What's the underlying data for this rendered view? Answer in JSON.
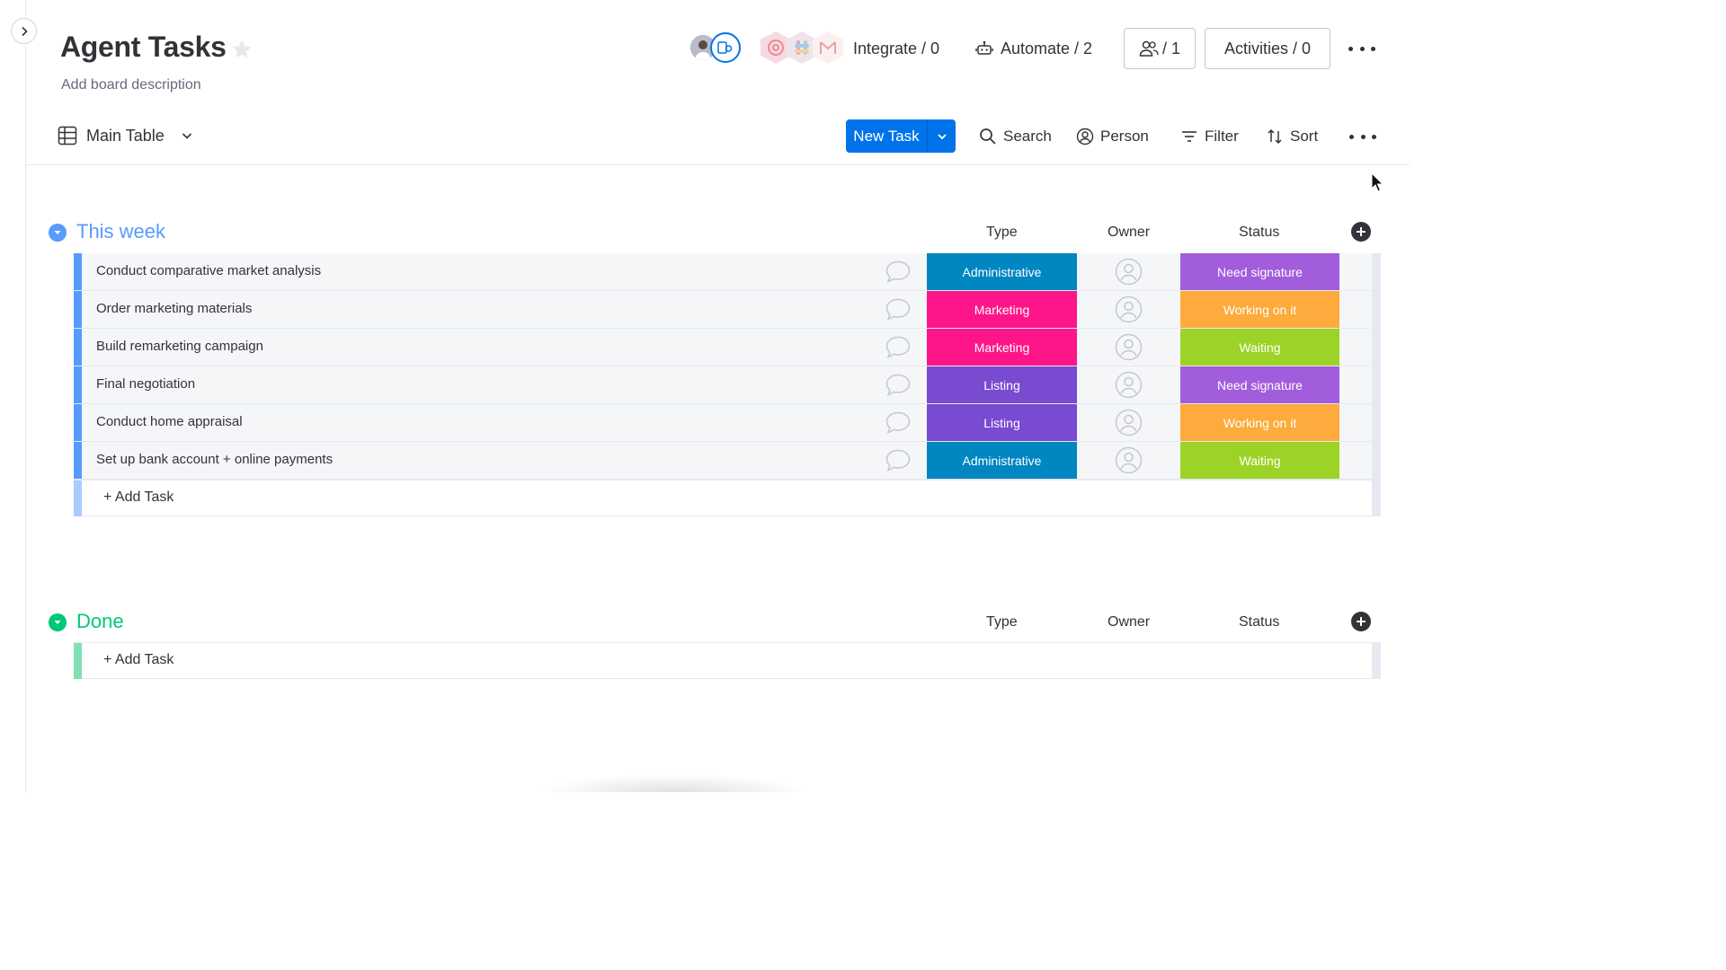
{
  "board": {
    "title": "Agent Tasks",
    "description": "Add board description"
  },
  "header": {
    "integrate_label": "Integrate / 0",
    "automate_label": "Automate / 2",
    "members_count": "/ 1",
    "activities_label": "Activities / 0"
  },
  "toolbar": {
    "view_label": "Main Table",
    "new_task_label": "New Task",
    "search_label": "Search",
    "person_label": "Person",
    "filter_label": "Filter",
    "sort_label": "Sort"
  },
  "columns": {
    "type": "Type",
    "owner": "Owner",
    "status": "Status"
  },
  "groups": [
    {
      "title": "This week",
      "color": "#579bfc",
      "add_label": "+ Add Task",
      "rows": [
        {
          "name": "Conduct comparative market analysis",
          "type": "Administrative",
          "type_color": "#0086c0",
          "status": "Need signature",
          "status_color": "#a25ddc"
        },
        {
          "name": "Order marketing materials",
          "type": "Marketing",
          "type_color": "#ff158a",
          "status": "Working on it",
          "status_color": "#fdab3d"
        },
        {
          "name": "Build remarketing campaign",
          "type": "Marketing",
          "type_color": "#ff158a",
          "status": "Waiting",
          "status_color": "#9cd326"
        },
        {
          "name": "Final negotiation",
          "type": "Listing",
          "type_color": "#784bd1",
          "status": "Need signature",
          "status_color": "#a25ddc"
        },
        {
          "name": "Conduct home appraisal",
          "type": "Listing",
          "type_color": "#784bd1",
          "status": "Working on it",
          "status_color": "#fdab3d"
        },
        {
          "name": "Set up bank account + online payments",
          "type": "Administrative",
          "type_color": "#0086c0",
          "status": "Waiting",
          "status_color": "#9cd326"
        }
      ]
    },
    {
      "title": "Done",
      "color": "#00c875",
      "add_label": "+ Add Task",
      "rows": []
    }
  ],
  "colors": {
    "primary": "#0073ea",
    "row_bar_blue": "#579bfc",
    "row_bar_blue_light": "#a9ccfe",
    "row_bar_green_light": "#80e0b1"
  }
}
